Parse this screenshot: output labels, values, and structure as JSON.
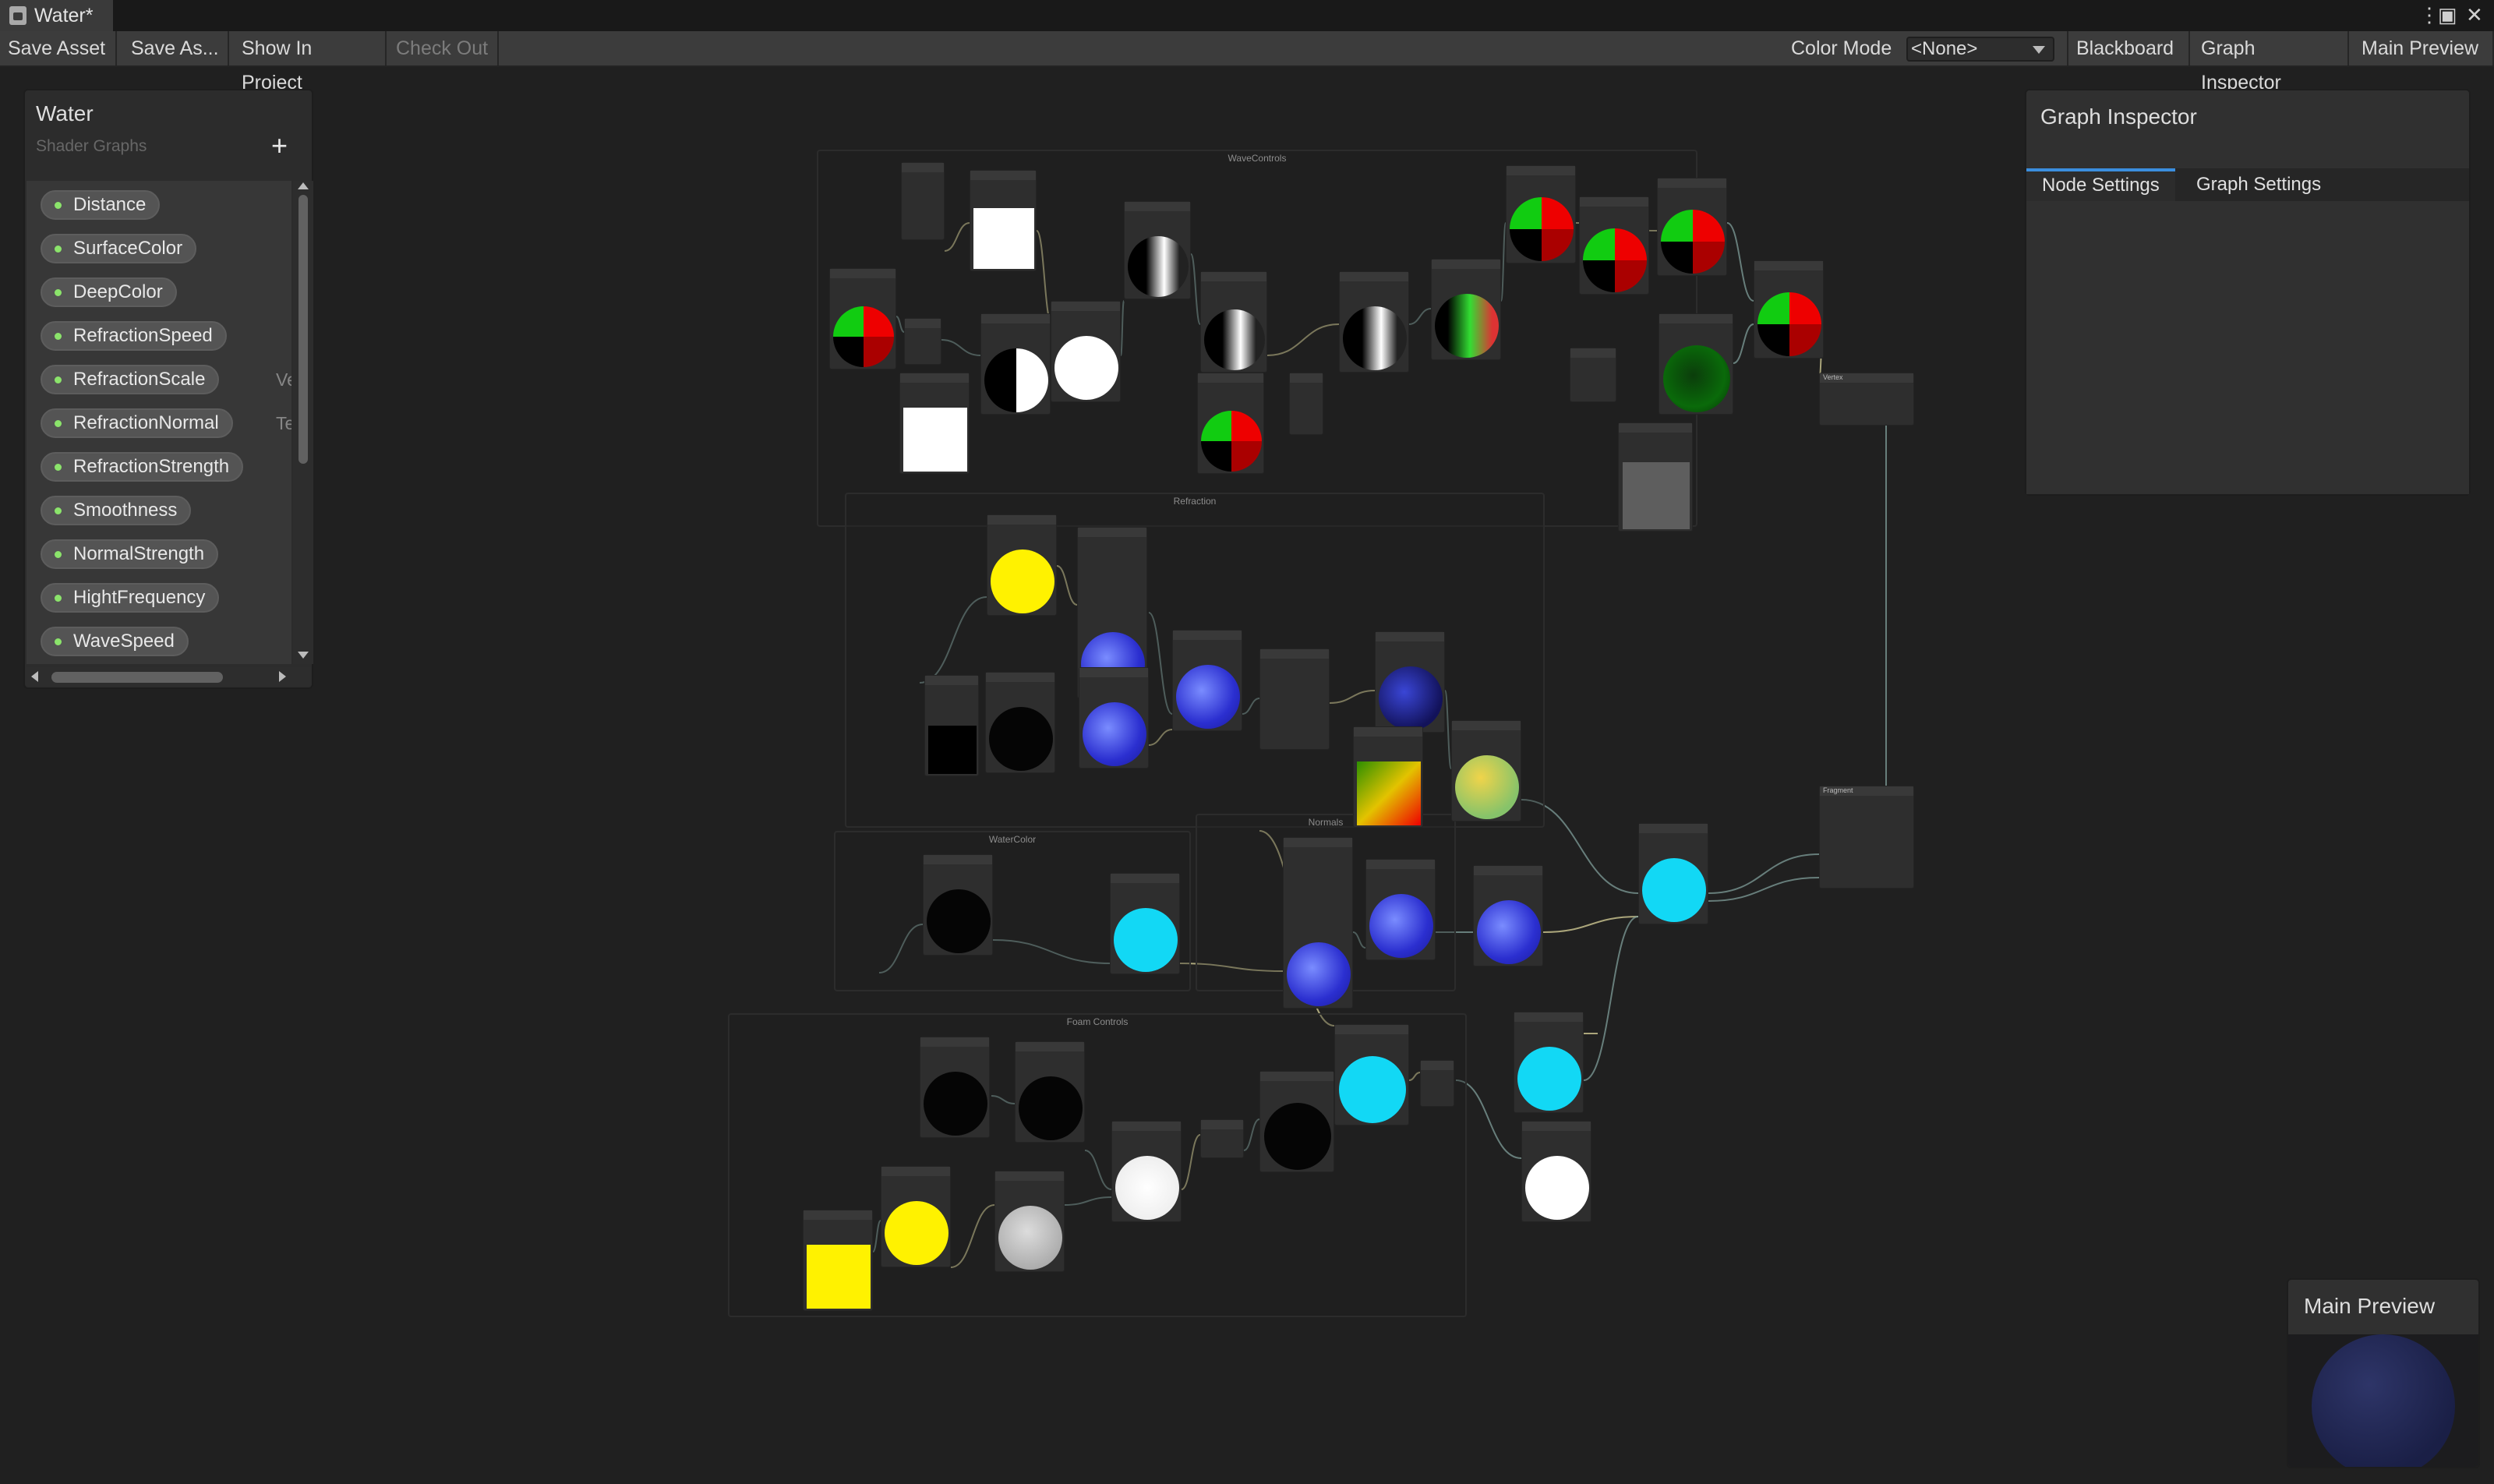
{
  "window": {
    "tab_title": "Water*",
    "menu_icon": "kebab-menu-icon",
    "maximize_icon": "maximize-icon",
    "close_icon": "close-icon"
  },
  "toolbar": {
    "save_asset": "Save Asset",
    "save_as": "Save As...",
    "show_in_project": "Show In Project",
    "check_out": "Check Out",
    "color_mode_label": "Color Mode",
    "color_mode_value": "<None>",
    "blackboard": "Blackboard",
    "graph_inspector": "Graph Inspector",
    "main_preview": "Main Preview"
  },
  "blackboard": {
    "title": "Water",
    "subtitle": "Shader Graphs",
    "add_icon": "plus-icon",
    "properties": [
      {
        "name": "Distance",
        "type": ""
      },
      {
        "name": "SurfaceColor",
        "type": ""
      },
      {
        "name": "DeepColor",
        "type": ""
      },
      {
        "name": "RefractionSpeed",
        "type": ""
      },
      {
        "name": "RefractionScale",
        "type": "Ve"
      },
      {
        "name": "RefractionNormal",
        "type": "Textu"
      },
      {
        "name": "RefractionStrength",
        "type": ""
      },
      {
        "name": "Smoothness",
        "type": ""
      },
      {
        "name": "NormalStrength",
        "type": ""
      },
      {
        "name": "HightFrequency",
        "type": ""
      },
      {
        "name": "WaveSpeed",
        "type": ""
      }
    ]
  },
  "inspector": {
    "title": "Graph Inspector",
    "tabs": [
      "Node Settings",
      "Graph Settings"
    ],
    "active_tab": "Node Settings"
  },
  "main_preview": {
    "title": "Main Preview"
  },
  "graph": {
    "groups": [
      {
        "id": "wave",
        "title": "WaveControls"
      },
      {
        "id": "refraction",
        "title": "Refraction"
      },
      {
        "id": "watercolor",
        "title": "WaterColor"
      },
      {
        "id": "normals",
        "title": "Normals"
      },
      {
        "id": "foam",
        "title": "Foam Controls"
      }
    ],
    "stacks": [
      {
        "id": "vertex",
        "title": "Vertex"
      },
      {
        "id": "fragment",
        "title": "Fragment"
      }
    ]
  },
  "colors": {
    "background": "#202020",
    "toolbar": "#3c3c3c",
    "accent": "#3b8ede",
    "property_dot": "#8be46b",
    "wire_float": "#7f9e9a",
    "wire_vector": "#d9d39a"
  }
}
